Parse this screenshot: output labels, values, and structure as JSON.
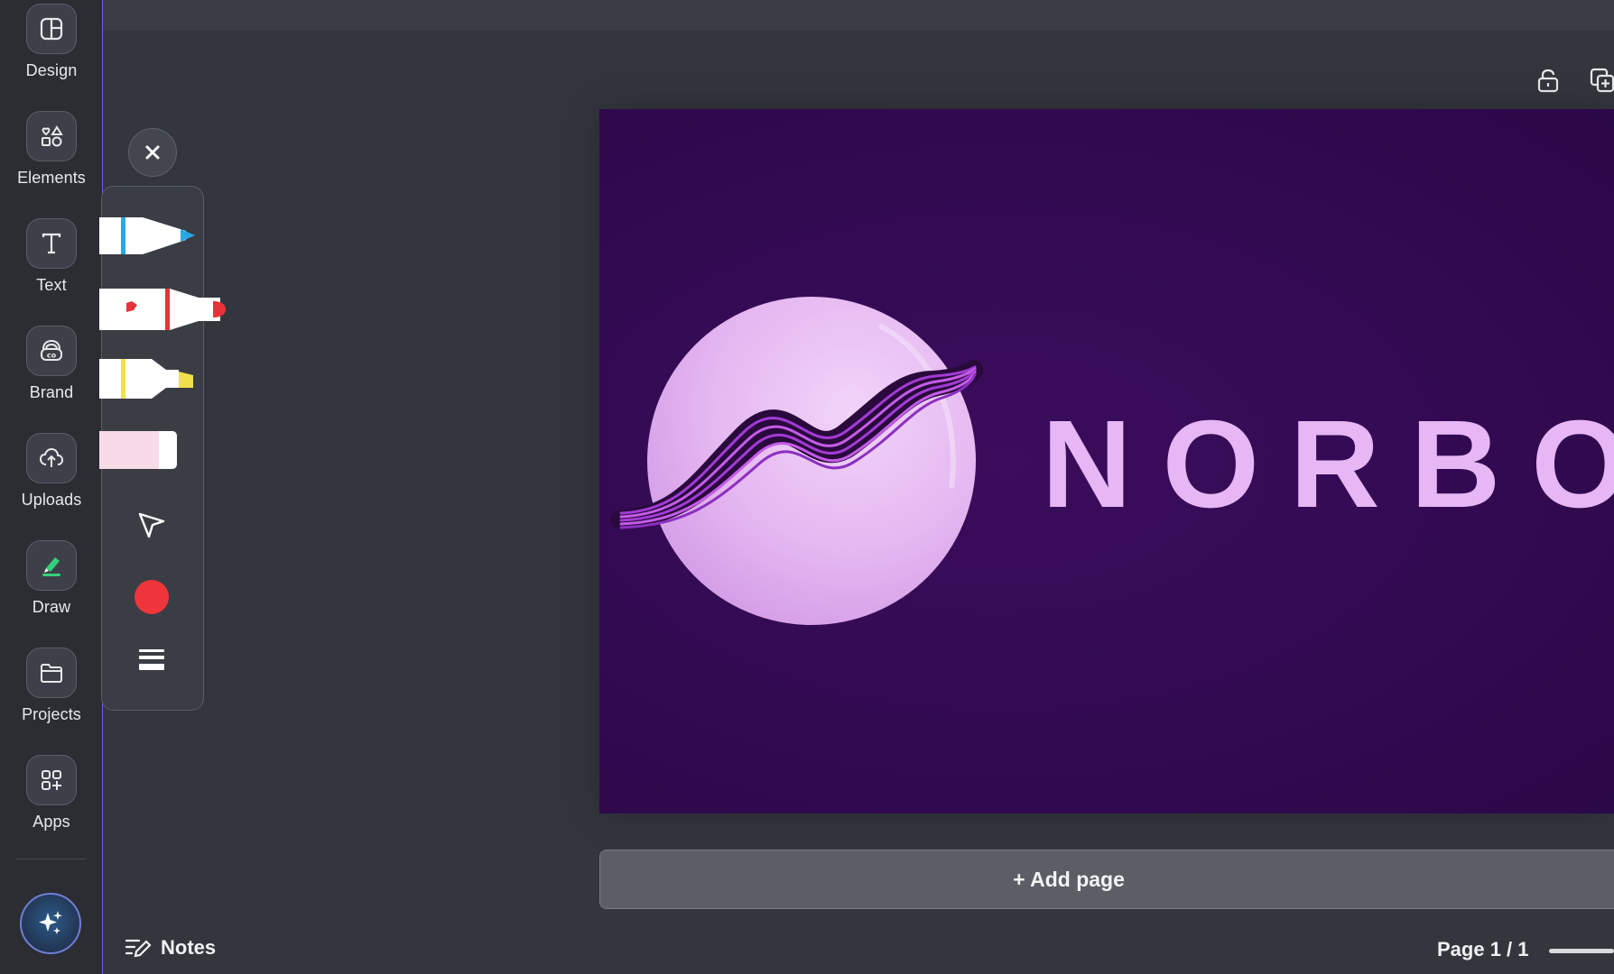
{
  "sidebar": {
    "items": [
      {
        "label": "Design",
        "icon": "design-layout-icon"
      },
      {
        "label": "Elements",
        "icon": "elements-shapes-icon"
      },
      {
        "label": "Text",
        "icon": "text-t-icon"
      },
      {
        "label": "Brand",
        "icon": "brand-icon"
      },
      {
        "label": "Uploads",
        "icon": "cloud-upload-icon"
      },
      {
        "label": "Draw",
        "icon": "draw-marker-icon",
        "active": true
      },
      {
        "label": "Projects",
        "icon": "folder-icon"
      },
      {
        "label": "Apps",
        "icon": "apps-grid-plus-icon"
      }
    ],
    "magic_button_icon": "sparkle-icon"
  },
  "draw_toolbar": {
    "tools": [
      {
        "name": "pen",
        "color": "#2aa8e6"
      },
      {
        "name": "marker",
        "color": "#e8333a"
      },
      {
        "name": "highlighter",
        "color": "#f0e04a"
      },
      {
        "name": "eraser",
        "color": "#f7dbe6"
      }
    ],
    "selected_color": "#f0353a"
  },
  "canvas": {
    "brand_text": "NORBO",
    "background": "#340a55",
    "text_color": "#e7b6f4"
  },
  "add_page_label": "+ Add page",
  "footer": {
    "notes_label": "Notes",
    "page_indicator": "Page 1 / 1"
  }
}
